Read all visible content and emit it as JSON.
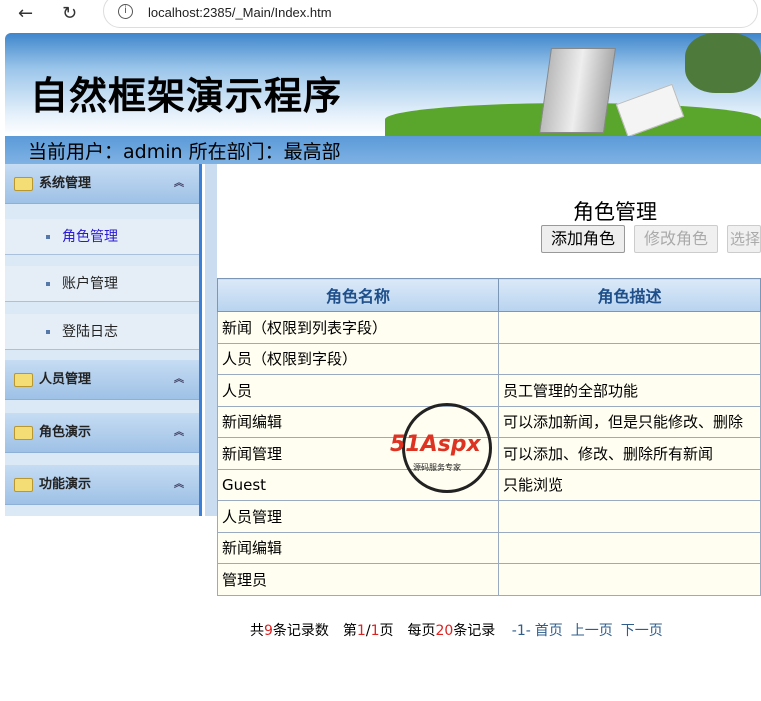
{
  "browser": {
    "url": "localhost:2385/_Main/Index.htm"
  },
  "header": {
    "title": "自然框架演示程序",
    "user_info": "当前用户：admin 所在部门：最高部"
  },
  "sidebar": {
    "groups": [
      {
        "label": "系统管理",
        "items": [
          {
            "label": "角色管理",
            "active": true
          },
          {
            "label": "账户管理"
          },
          {
            "label": "登陆日志"
          }
        ]
      },
      {
        "label": "人员管理"
      },
      {
        "label": "角色演示"
      },
      {
        "label": "功能演示"
      }
    ]
  },
  "main": {
    "title": "角色管理",
    "buttons": {
      "add": "添加角色",
      "edit": "修改角色",
      "select": "选择"
    },
    "table": {
      "headers": [
        "角色名称",
        "角色描述"
      ],
      "rows": [
        [
          "新闻（权限到列表字段）",
          ""
        ],
        [
          "人员（权限到字段）",
          ""
        ],
        [
          "人员",
          "员工管理的全部功能"
        ],
        [
          "新闻编辑",
          "可以添加新闻，但是只能修改、删除"
        ],
        [
          "新闻管理",
          "可以添加、修改、删除所有新闻"
        ],
        [
          "Guest",
          "只能浏览"
        ],
        [
          "人员管理",
          ""
        ],
        [
          "新闻编辑",
          ""
        ],
        [
          "管理员",
          ""
        ]
      ]
    },
    "pager": {
      "p1": "共",
      "total": "9",
      "p2": "条记录数　第",
      "page": "1",
      "sep": "/",
      "pages": "1",
      "p3": "页　每页",
      "per": "20",
      "p4": "条记录",
      "cur": "-1-",
      "first": "首页",
      "prev": "上一页",
      "next": "下一页"
    }
  },
  "watermark": {
    "text": "51Aspx",
    "sub": "源码服务专家"
  }
}
